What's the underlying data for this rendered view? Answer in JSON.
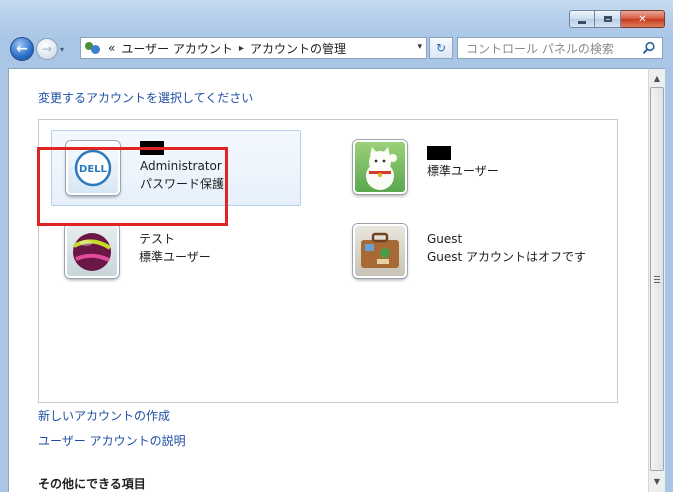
{
  "window": {
    "caption": {
      "minimize": "",
      "maximize": "",
      "close": "✕"
    }
  },
  "nav": {
    "back_glyph": "←",
    "forward_glyph": "→",
    "history_glyph": "▾",
    "breadcrumb": {
      "overflow": "«",
      "items": [
        "ユーザー アカウント",
        "アカウントの管理"
      ],
      "separator": "▸"
    },
    "refresh_glyph": "↻",
    "search_placeholder": "コントロール パネルの検索"
  },
  "main": {
    "heading": "変更するアカウントを選択してください",
    "accounts": [
      {
        "name_redacted": true,
        "role": "Administrator",
        "status": "パスワード保護",
        "picture": "dell-logo",
        "selected": true
      },
      {
        "name_redacted": true,
        "role": "標準ユーザー",
        "picture": "lucky-cat"
      },
      {
        "name": "テスト",
        "role": "標準ユーザー",
        "picture": "purple-ball",
        "highlighted": true
      },
      {
        "name": "Guest",
        "status": "Guest アカウントはオフです",
        "picture": "suitcase"
      }
    ],
    "links": [
      "新しいアカウントの作成",
      "ユーザー アカウントの説明"
    ],
    "more_section": "その他にできる項目"
  },
  "colors": {
    "link": "#1f4fa3",
    "highlight": "#e02424",
    "selected_bg": "#e6f0fb"
  }
}
